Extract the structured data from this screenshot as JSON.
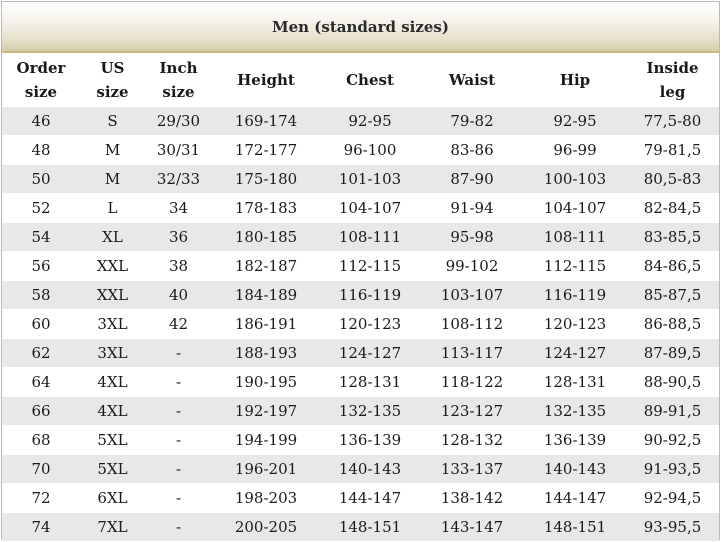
{
  "title": "Men (standard sizes)",
  "headers": [
    [
      "Order",
      "size"
    ],
    [
      "US",
      "size"
    ],
    [
      "Inch",
      "size"
    ],
    [
      "Height"
    ],
    [
      "Chest"
    ],
    [
      "Waist"
    ],
    [
      "Hip"
    ],
    [
      "Inside",
      "leg"
    ]
  ],
  "rows": [
    [
      "46",
      "S",
      "29/30",
      "169-174",
      "92-95",
      "79-82",
      "92-95",
      "77,5-80"
    ],
    [
      "48",
      "M",
      "30/31",
      "172-177",
      "96-100",
      "83-86",
      "96-99",
      "79-81,5"
    ],
    [
      "50",
      "M",
      "32/33",
      "175-180",
      "101-103",
      "87-90",
      "100-103",
      "80,5-83"
    ],
    [
      "52",
      "L",
      "34",
      "178-183",
      "104-107",
      "91-94",
      "104-107",
      "82-84,5"
    ],
    [
      "54",
      "XL",
      "36",
      "180-185",
      "108-111",
      "95-98",
      "108-111",
      "83-85,5"
    ],
    [
      "56",
      "XXL",
      "38",
      "182-187",
      "112-115",
      "99-102",
      "112-115",
      "84-86,5"
    ],
    [
      "58",
      "XXL",
      "40",
      "184-189",
      "116-119",
      "103-107",
      "116-119",
      "85-87,5"
    ],
    [
      "60",
      "3XL",
      "42",
      "186-191",
      "120-123",
      "108-112",
      "120-123",
      "86-88,5"
    ],
    [
      "62",
      "3XL",
      "-",
      "188-193",
      "124-127",
      "113-117",
      "124-127",
      "87-89,5"
    ],
    [
      "64",
      "4XL",
      "-",
      "190-195",
      "128-131",
      "118-122",
      "128-131",
      "88-90,5"
    ],
    [
      "66",
      "4XL",
      "-",
      "192-197",
      "132-135",
      "123-127",
      "132-135",
      "89-91,5"
    ],
    [
      "68",
      "5XL",
      "-",
      "194-199",
      "136-139",
      "128-132",
      "136-139",
      "90-92,5"
    ],
    [
      "70",
      "5XL",
      "-",
      "196-201",
      "140-143",
      "133-137",
      "140-143",
      "91-93,5"
    ],
    [
      "72",
      "6XL",
      "-",
      "198-203",
      "144-147",
      "138-142",
      "144-147",
      "92-94,5"
    ],
    [
      "74",
      "7XL",
      "-",
      "200-205",
      "148-151",
      "143-147",
      "148-151",
      "93-95,5"
    ]
  ],
  "colors": {
    "stripe": "#e8e8e8",
    "banner_gold": "#d6cca9"
  }
}
